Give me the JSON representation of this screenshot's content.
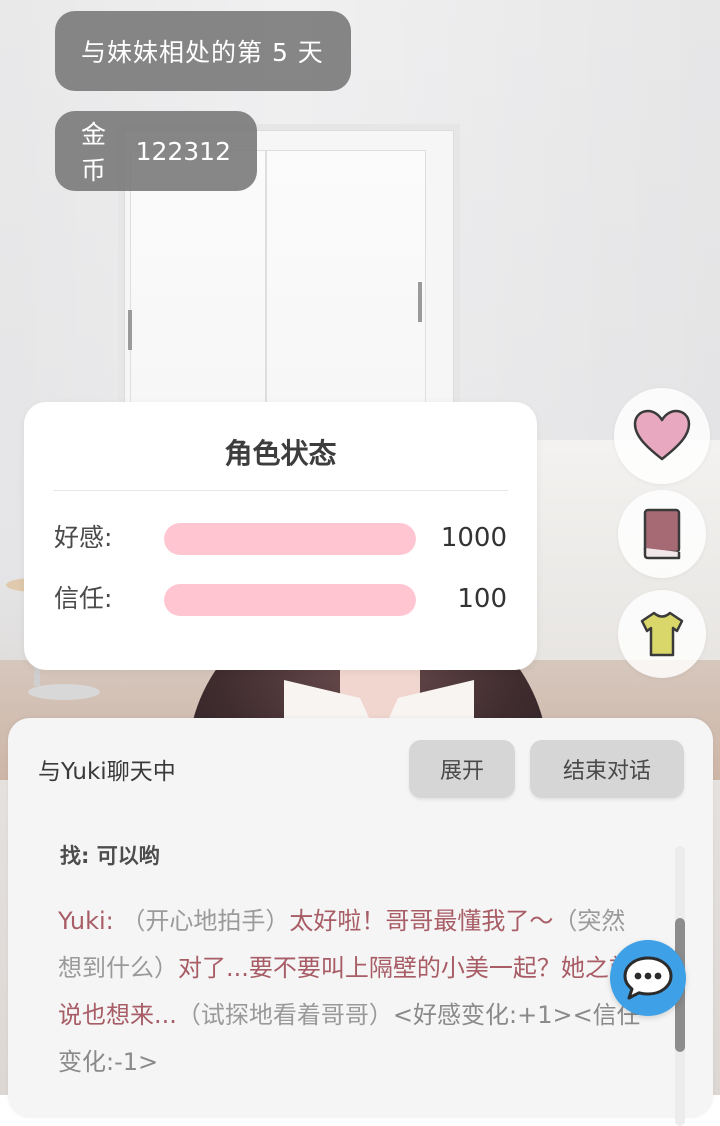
{
  "header": {
    "day_counter": "与妹妹相处的第 5 天",
    "gold_label": "金币",
    "gold_value": "122312"
  },
  "status_card": {
    "title": "角色状态",
    "stats": [
      {
        "label": "好感:",
        "value": "1000",
        "fill_fraction": 1.0
      },
      {
        "label": "信任:",
        "value": "100",
        "fill_fraction": 1.0
      }
    ],
    "bar_color": "#ffc6d1"
  },
  "side_buttons": [
    {
      "icon": "heart-icon",
      "color": "#e8a8bf"
    },
    {
      "icon": "book-icon",
      "color": "#a56a73"
    },
    {
      "icon": "shirt-icon",
      "color": "#d9d76a"
    }
  ],
  "chat": {
    "title": "与Yuki聊天中",
    "expand_label": "展开",
    "end_label": "结束对话",
    "messages": [
      {
        "speaker": "找:",
        "text": "可以哟"
      },
      {
        "speaker": "Yuki:",
        "part1_action": "（开心地拍手）",
        "part2_speech": "太好啦！哥哥最懂我了～",
        "part3_action": "（突然想到什么）",
        "part4_speech": "对了...要不要叫上隔壁的小美一起？她之前说也想来...",
        "part5_action": "（试探地看着哥哥）",
        "part6_meta": "<好感变化:+1><信任变化:-1>"
      }
    ],
    "speaker_color": "#a85d66",
    "fab_icon": "chat-bubble-icon",
    "fab_color": "#3ea0e6"
  }
}
